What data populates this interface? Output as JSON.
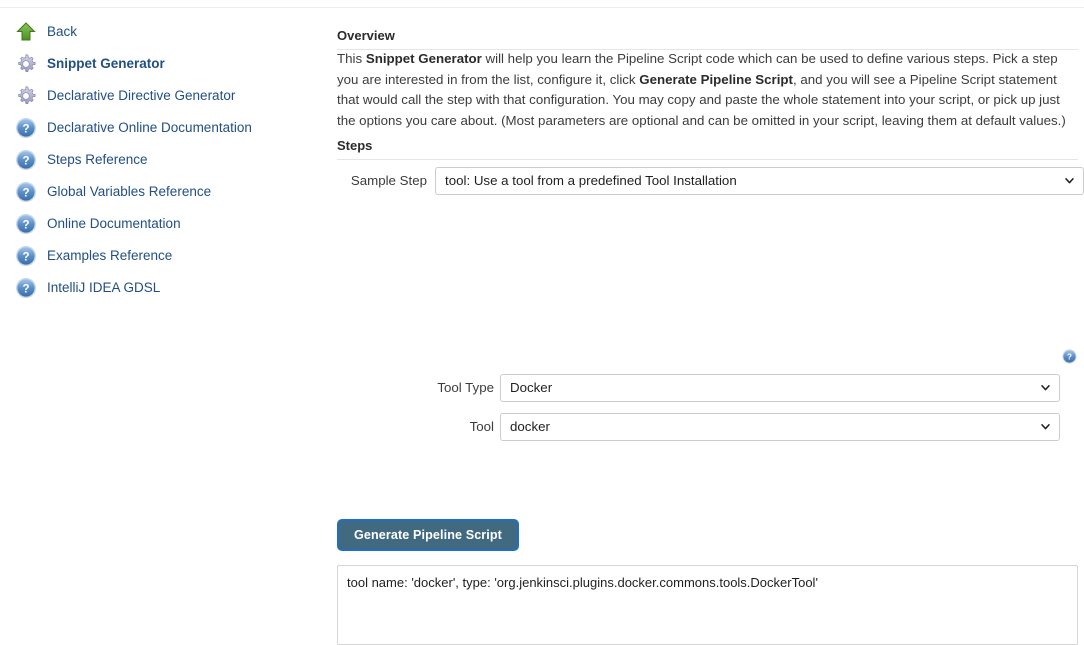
{
  "sidebar": {
    "items": [
      {
        "label": "Back",
        "icon": "up-arrow-icon",
        "active": false
      },
      {
        "label": "Snippet Generator",
        "icon": "gear-icon",
        "active": true
      },
      {
        "label": "Declarative Directive Generator",
        "icon": "gear-icon",
        "active": false
      },
      {
        "label": "Declarative Online Documentation",
        "icon": "help-icon",
        "active": false
      },
      {
        "label": "Steps Reference",
        "icon": "help-icon",
        "active": false
      },
      {
        "label": "Global Variables Reference",
        "icon": "help-icon",
        "active": false
      },
      {
        "label": "Online Documentation",
        "icon": "help-icon",
        "active": false
      },
      {
        "label": "Examples Reference",
        "icon": "help-icon",
        "active": false
      },
      {
        "label": "IntelliJ IDEA GDSL",
        "icon": "help-icon",
        "active": false
      }
    ]
  },
  "overview": {
    "heading": "Overview",
    "text_part1": "This ",
    "bold1": "Snippet Generator",
    "text_part2": " will help you learn the Pipeline Script code which can be used to define various steps. Pick a step you are interested in from the list, configure it, click ",
    "bold2": "Generate Pipeline Script",
    "text_part3": ", and you will see a Pipeline Script statement that would call the step with that configuration. You may copy and paste the whole statement into your script, or pick up just the options you care about. (Most parameters are optional and can be omitted in your script, leaving them at default values.)"
  },
  "steps": {
    "heading": "Steps",
    "sample_step": {
      "label": "Sample Step",
      "value": "tool: Use a tool from a predefined Tool Installation",
      "options": [
        "tool: Use a tool from a predefined Tool Installation"
      ]
    }
  },
  "tool_config": {
    "help_icon": "help-icon",
    "tool_type": {
      "label": "Tool Type",
      "value": "Docker",
      "options": [
        "Docker"
      ]
    },
    "tool": {
      "label": "Tool",
      "value": "docker",
      "options": [
        "docker"
      ]
    }
  },
  "actions": {
    "generate_label": "Generate Pipeline Script"
  },
  "output": {
    "value": "tool name: 'docker', type: 'org.jenkinsci.plugins.docker.commons.tools.DockerTool'",
    "placeholder": ""
  },
  "colors": {
    "link_blue": "#214f86",
    "button_fill": "#41697f",
    "button_ring": "#1f6fc4",
    "arrow_green": "#5aa02c",
    "gear_lavender": "#b9b8d8",
    "help_blue": "#5b8fc9"
  }
}
